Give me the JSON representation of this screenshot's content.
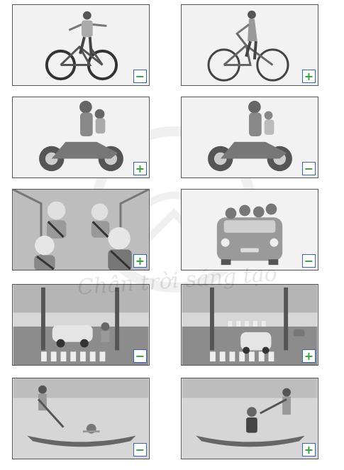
{
  "watermark": {
    "text": "Chân trời sáng tạo"
  },
  "colors": {
    "badge_border": "#3366cc",
    "badge_symbol": "#2fa33a",
    "card_border": "#555555"
  },
  "cards": [
    {
      "scene": "child-riding-bicycle-hands-off",
      "badge": "−"
    },
    {
      "scene": "woman-riding-bicycle",
      "badge": "+"
    },
    {
      "scene": "motorbike-with-helmets",
      "badge": "+"
    },
    {
      "scene": "motorbike-child-without-helmet",
      "badge": "−"
    },
    {
      "scene": "family-wearing-seatbelts-in-car",
      "badge": "+"
    },
    {
      "scene": "children-leaning-out-car-window",
      "badge": "−"
    },
    {
      "scene": "child-crossing-in-front-of-car",
      "badge": "−"
    },
    {
      "scene": "car-stopping-at-crosswalk",
      "badge": "+"
    },
    {
      "scene": "child-fell-in-water-from-boat",
      "badge": "−"
    },
    {
      "scene": "child-sitting-in-boat-with-lifejacket",
      "badge": "+"
    }
  ]
}
